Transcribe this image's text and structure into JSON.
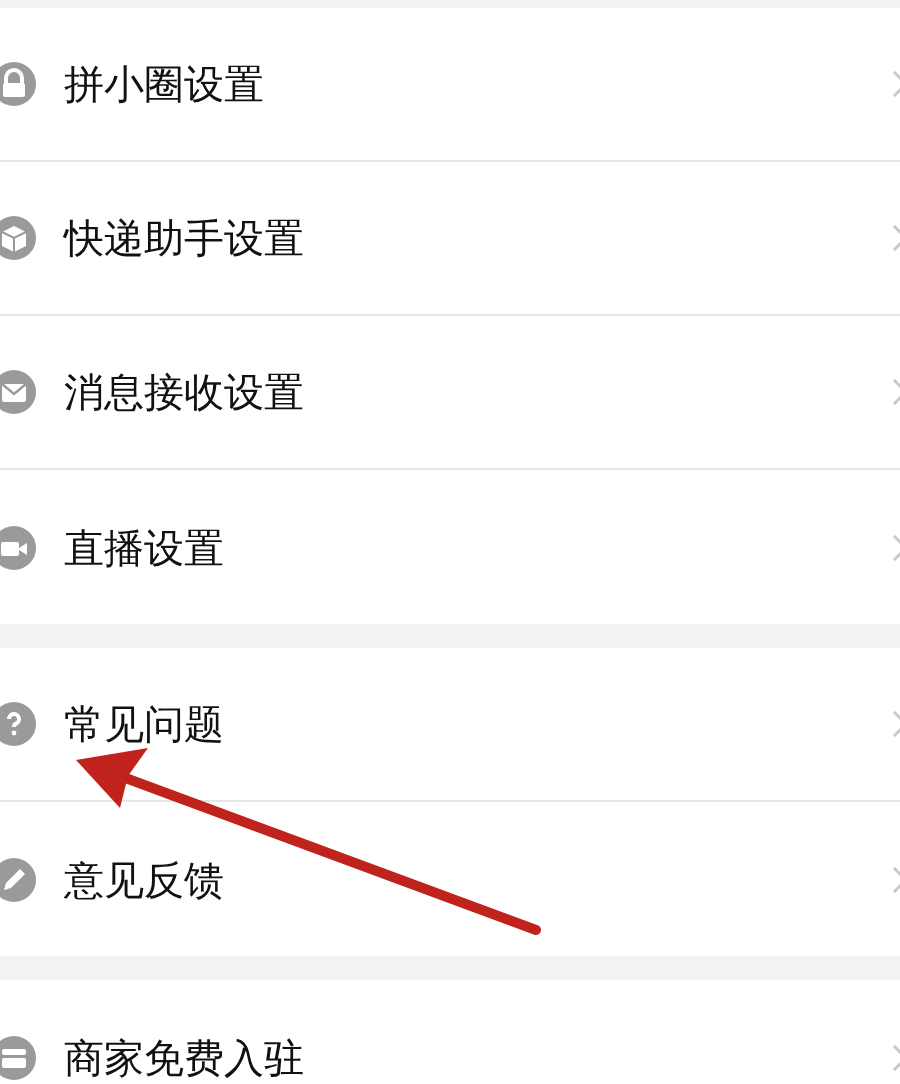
{
  "sections": [
    {
      "items": [
        {
          "label": "拼小圈设置"
        },
        {
          "label": "快递助手设置"
        },
        {
          "label": "消息接收设置"
        },
        {
          "label": "直播设置"
        }
      ]
    },
    {
      "items": [
        {
          "label": "常见问题"
        },
        {
          "label": "意见反馈"
        }
      ]
    },
    {
      "items": [
        {
          "label": "商家免费入驻"
        }
      ]
    }
  ],
  "annotations": [
    {
      "kind": "arrow"
    }
  ]
}
